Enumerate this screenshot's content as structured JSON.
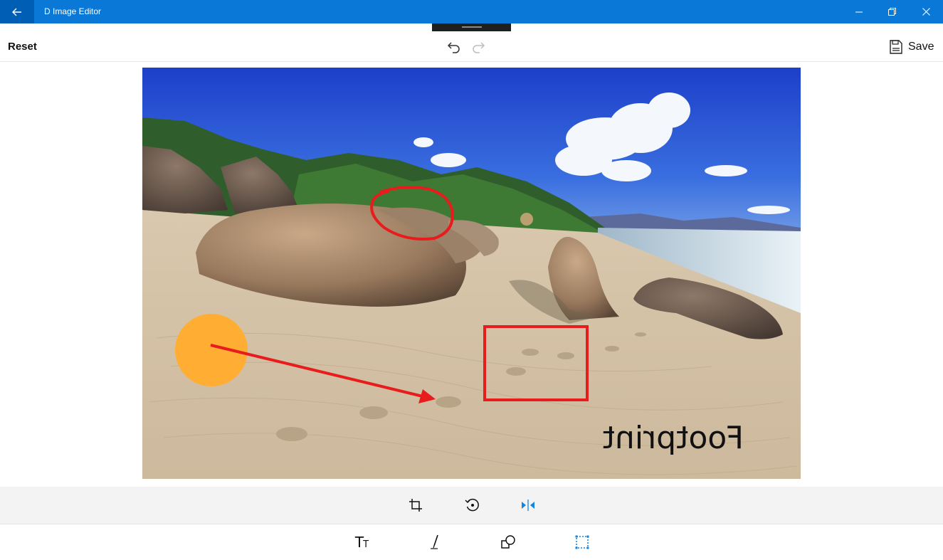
{
  "titlebar": {
    "title": "D Image Editor",
    "back_icon": "arrow-left-icon",
    "minimize_icon": "minimize-icon",
    "restore_icon": "restore-icon",
    "close_icon": "close-icon"
  },
  "commandbar": {
    "reset_label": "Reset",
    "undo_icon": "undo-icon",
    "redo_icon": "redo-icon",
    "save_label": "Save",
    "save_icon": "floppy-disk-icon"
  },
  "canvas": {
    "annotation_text": "Footprint",
    "annotation_text_mirrored": true,
    "shapes": [
      {
        "kind": "freehand-ellipse",
        "color": "#e81c1c"
      },
      {
        "kind": "filled-circle",
        "color": "#ffad33"
      },
      {
        "kind": "arrow",
        "color": "#e81c1c"
      },
      {
        "kind": "rectangle",
        "color": "#e81c1c"
      }
    ]
  },
  "toolbar_top": [
    {
      "name": "crop",
      "icon": "crop-icon",
      "active": false
    },
    {
      "name": "rotate",
      "icon": "rotate-icon",
      "active": false
    },
    {
      "name": "flip",
      "icon": "flip-horizontal-icon",
      "active": true
    }
  ],
  "toolbar_bottom": [
    {
      "name": "text",
      "icon": "text-tool-icon",
      "active": false
    },
    {
      "name": "draw",
      "icon": "pen-icon",
      "active": false
    },
    {
      "name": "shapes",
      "icon": "shapes-icon",
      "active": false
    },
    {
      "name": "select",
      "icon": "selection-icon",
      "active": true
    }
  ],
  "colors": {
    "titlebar": "#0a78d7",
    "titlebar_back": "#005fb5",
    "accent": "#1185e0",
    "annotation_red": "#e81c1c",
    "annotation_orange": "#ffad33"
  }
}
